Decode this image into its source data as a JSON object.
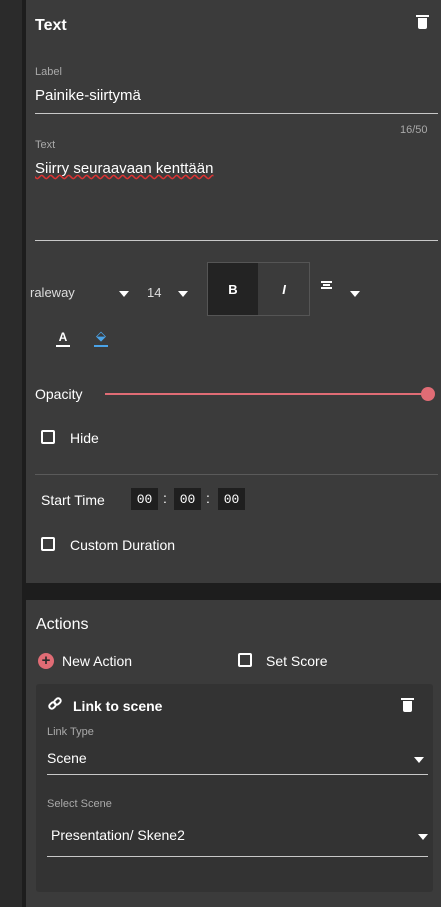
{
  "text_panel": {
    "title": "Text",
    "label_field": {
      "label": "Label",
      "value": "Painike-siirtymä"
    },
    "text_field": {
      "label": "Text",
      "value": "Siirry seuraavaan kenttään",
      "counter": "16/50"
    },
    "toolbar": {
      "font": "raleway",
      "size": "14",
      "bold": "B",
      "italic": "I",
      "font_color_glyph": "A"
    },
    "opacity": {
      "label": "Opacity",
      "value": 1.0
    },
    "hide": {
      "label": "Hide",
      "checked": false
    },
    "start_time": {
      "label": "Start Time",
      "hh": "00",
      "mm": "00",
      "ss": "00"
    },
    "custom_duration": {
      "label": "Custom Duration",
      "checked": false
    }
  },
  "actions": {
    "title": "Actions",
    "new_action": "New Action",
    "set_score": "Set Score",
    "card": {
      "title": "Link to scene",
      "link_type_label": "Link Type",
      "link_type_value": "Scene",
      "select_scene_label": "Select Scene",
      "select_scene_value": "Presentation/ Skene2"
    }
  },
  "colors": {
    "accent": "#e06c75",
    "fill_icon": "#4aa3e8",
    "panel": "#3b3b3b",
    "background": "#1d1d1d"
  }
}
